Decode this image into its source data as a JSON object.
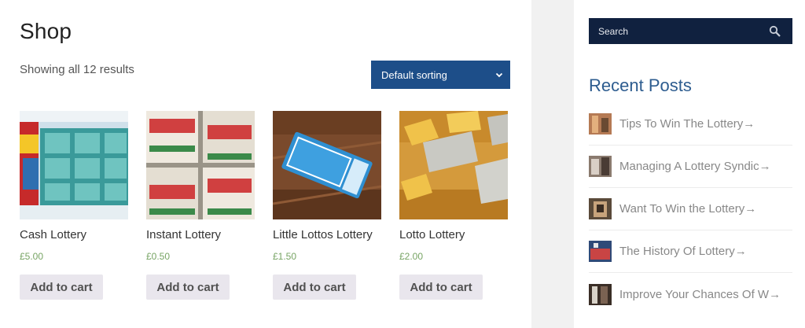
{
  "shop": {
    "title": "Shop",
    "result_count": "Showing all 12 results",
    "sorting": {
      "selected": "Default sorting"
    }
  },
  "products": [
    {
      "name": "Cash Lottery",
      "price": "£5.00",
      "button": "Add to cart",
      "image_icon": "scratch-card-image"
    },
    {
      "name": "Instant Lottery",
      "price": "£0.50",
      "button": "Add to cart",
      "image_icon": "lottery-tickets-image"
    },
    {
      "name": "Little Lottos Lottery",
      "price": "£1.50",
      "button": "Add to cart",
      "image_icon": "ticket-stub-image"
    },
    {
      "name": "Lotto Lottery",
      "price": "£2.00",
      "button": "Add to cart",
      "image_icon": "numbered-tickets-image"
    }
  ],
  "sidebar": {
    "search": {
      "placeholder": "Search"
    },
    "recent_posts_title": "Recent Posts",
    "recent_posts": [
      {
        "title": "Tips To Win The Lottery→"
      },
      {
        "title": "Managing A Lottery Syndic→"
      },
      {
        "title": "Want To Win the Lottery→"
      },
      {
        "title": "The History Of Lottery→"
      },
      {
        "title": "Improve Your Chances Of W→"
      }
    ]
  },
  "colors": {
    "sort_bg": "#1d4e89",
    "search_bg": "#10213f",
    "widget_title": "#2d5c8f",
    "price": "#77a464",
    "button_bg": "#e9e6ed",
    "gutter": "#f1f1f1"
  }
}
